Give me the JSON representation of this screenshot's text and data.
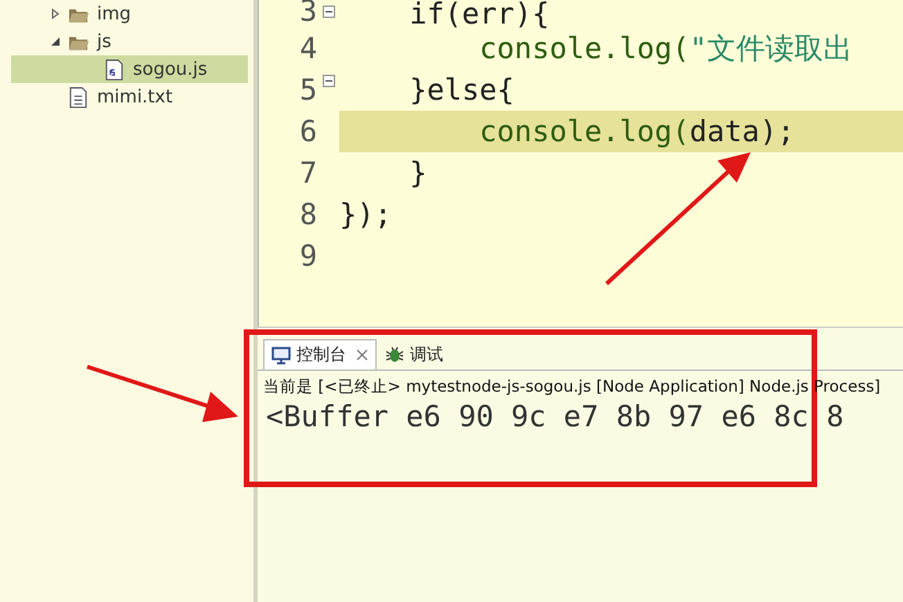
{
  "project_tree": [
    {
      "name": "img",
      "kind": "folder",
      "expanded": false,
      "selected": false
    },
    {
      "name": "js",
      "kind": "folder",
      "expanded": true,
      "selected": false,
      "children": [
        {
          "name": "sogou.js",
          "kind": "js",
          "selected": true
        }
      ]
    },
    {
      "name": "mimi.txt",
      "kind": "text",
      "selected": false
    }
  ],
  "editor": {
    "lines": [
      {
        "number": "3",
        "foldable": true,
        "current": false,
        "tokens": [
          {
            "kind": "plain",
            "text": "    if(err){"
          }
        ]
      },
      {
        "number": "4",
        "foldable": false,
        "current": false,
        "tokens": [
          {
            "kind": "call",
            "text": "        console.log("
          },
          {
            "kind": "string",
            "text": "\"文件读取出"
          }
        ]
      },
      {
        "number": "5",
        "foldable": true,
        "current": false,
        "tokens": [
          {
            "kind": "plain",
            "text": "    }else{"
          }
        ]
      },
      {
        "number": "6",
        "foldable": false,
        "current": true,
        "tokens": [
          {
            "kind": "call",
            "text": "        console.log("
          },
          {
            "kind": "plain",
            "text": "data);"
          }
        ]
      },
      {
        "number": "7",
        "foldable": false,
        "current": false,
        "tokens": [
          {
            "kind": "plain",
            "text": "    }"
          }
        ]
      },
      {
        "number": "8",
        "foldable": false,
        "current": false,
        "tokens": [
          {
            "kind": "plain",
            "text": "});"
          }
        ]
      },
      {
        "number": "9",
        "foldable": false,
        "current": false
      }
    ]
  },
  "console": {
    "tabs": [
      {
        "label": "控制台",
        "kind": "console",
        "selected": true,
        "closable": true
      },
      {
        "label": "调试",
        "kind": "debug",
        "selected": false,
        "closable": false
      }
    ],
    "status": "当前是 [<已终止> mytestnode-js-sogou.js [Node Application] Node.js Process]",
    "output": "<Buffer e6 90 9c e7 8b 97 e6 8c 8"
  }
}
